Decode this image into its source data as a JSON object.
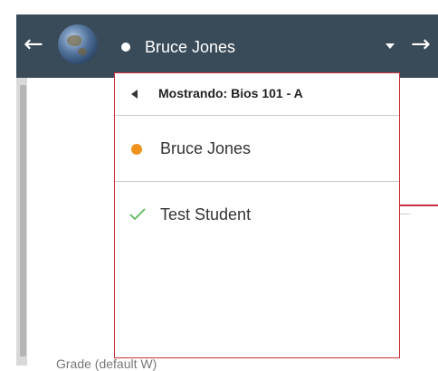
{
  "topbar": {
    "prev_icon": "arrow-left-icon",
    "next_icon": "arrow-right-icon",
    "avatar_icon": "globe-avatar-icon",
    "current_student": "Bruce Jones",
    "status_color": "#ffffff",
    "background_color": "#394b58"
  },
  "dropdown": {
    "header": "Mostrando: Bios 101 - A",
    "border_color": "#c9303a",
    "items": [
      {
        "label": "Bruce Jones",
        "status_icon": "orange-dot-icon",
        "status_color": "#f0921e"
      },
      {
        "label": "Test Student",
        "status_icon": "checkmark-icon",
        "status_color": "#5cb85c"
      }
    ]
  },
  "background": {
    "cut_off_text": "Grade (default W)"
  }
}
